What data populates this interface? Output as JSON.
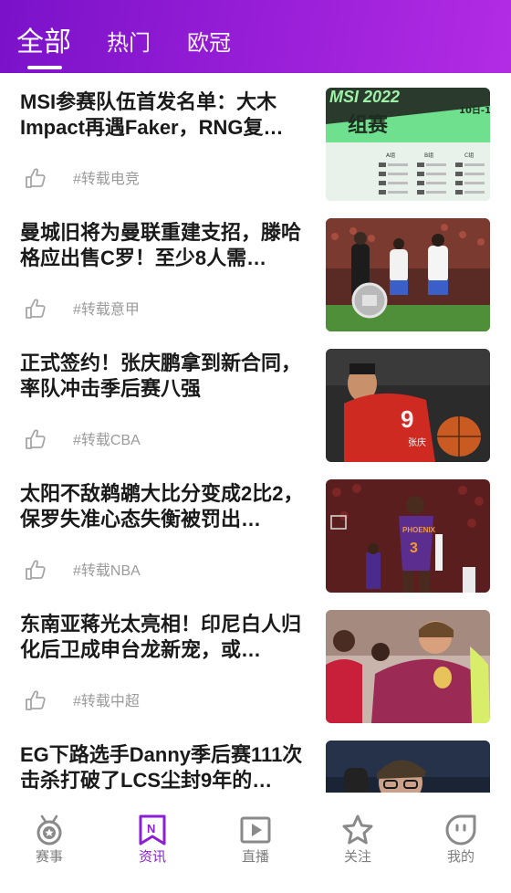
{
  "header": {
    "tabs": [
      {
        "label": "全部",
        "active": true
      },
      {
        "label": "热门",
        "active": false
      },
      {
        "label": "欧冠",
        "active": false
      }
    ],
    "accent_color": "#8d1ed4"
  },
  "feed": {
    "items": [
      {
        "title": "MSI参赛队伍首发名单：大木Impact再遇Faker，RNG复…",
        "tag": "#转载电竞",
        "image_text": [
          "MSI 2022",
          "组赛",
          "10日-1",
          "A组",
          "B组",
          "C组"
        ]
      },
      {
        "title": "曼城旧将为曼联重建支招，滕哈格应出售C罗！至少8人需…",
        "tag": "#转载意甲"
      },
      {
        "title": "正式签约！张庆鹏拿到新合同，率队冲击季后赛八强",
        "tag": "#转载CBA",
        "image_text": [
          "9",
          "张庆"
        ]
      },
      {
        "title": "太阳不敌鹈鹕大比分变成2比2，保罗失准心态失衡被罚出…",
        "tag": "#转载NBA",
        "image_text": [
          "PHOENIX",
          "3"
        ]
      },
      {
        "title": "东南亚蒋光太亮相！印尼白人归化后卫成申台龙新宠，或…",
        "tag": "#转载中超"
      },
      {
        "title": "EG下路选手Danny季后赛111次击杀打破了LCS尘封9年的…",
        "tag": ""
      }
    ]
  },
  "bottom_nav": {
    "items": [
      {
        "label": "赛事",
        "icon": "medal-icon",
        "active": false
      },
      {
        "label": "资讯",
        "icon": "news-bookmark-icon",
        "active": true
      },
      {
        "label": "直播",
        "icon": "play-icon",
        "active": false
      },
      {
        "label": "关注",
        "icon": "star-icon",
        "active": false
      },
      {
        "label": "我的",
        "icon": "profile-icon",
        "active": false
      }
    ]
  }
}
